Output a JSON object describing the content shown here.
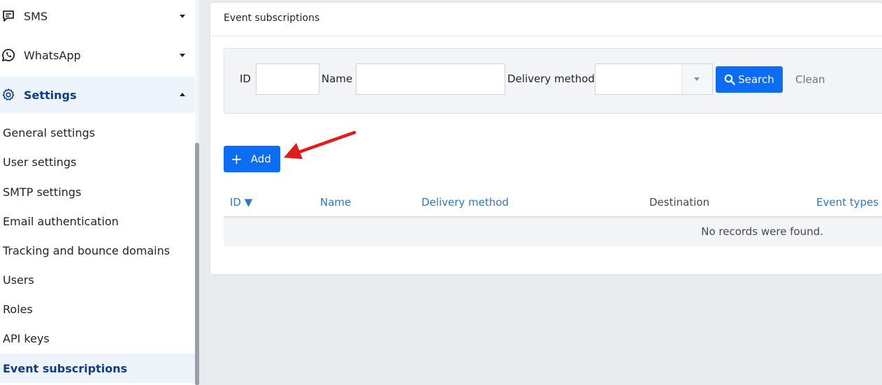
{
  "sidebar": {
    "sms_label": "SMS",
    "whatsapp_label": "WhatsApp",
    "settings_label": "Settings",
    "settings_items": [
      {
        "label": "General settings"
      },
      {
        "label": "User settings"
      },
      {
        "label": "SMTP settings"
      },
      {
        "label": "Email authentication"
      },
      {
        "label": "Tracking and bounce domains"
      },
      {
        "label": "Users"
      },
      {
        "label": "Roles"
      },
      {
        "label": "API keys"
      },
      {
        "label": "Event subscriptions"
      }
    ],
    "active_item": "Event subscriptions"
  },
  "page": {
    "title": "Event subscriptions"
  },
  "filters": {
    "id_label": "ID",
    "id_value": "",
    "name_label": "Name",
    "name_value": "",
    "delivery_label": "Delivery method",
    "delivery_value": "",
    "search_label": "Search",
    "clean_label": "Clean"
  },
  "actions": {
    "add_label": "Add"
  },
  "table": {
    "columns": [
      {
        "label": "ID",
        "sorted": "desc"
      },
      {
        "label": "Name"
      },
      {
        "label": "Delivery method"
      },
      {
        "label": "Destination"
      },
      {
        "label": "Event types"
      }
    ],
    "sort_indicator": "▼",
    "empty_message": "No records were found."
  },
  "colors": {
    "primary": "#0b6cf4",
    "active_bg": "#eef4fc",
    "active_text": "#0c3c8c",
    "link": "#2f79c2",
    "annotation_arrow": "#e31b1b"
  },
  "icons": {
    "sms": "chat-bubble-icon",
    "whatsapp": "whatsapp-icon",
    "settings": "gear-icon",
    "search": "search-icon",
    "add": "plus-icon"
  }
}
